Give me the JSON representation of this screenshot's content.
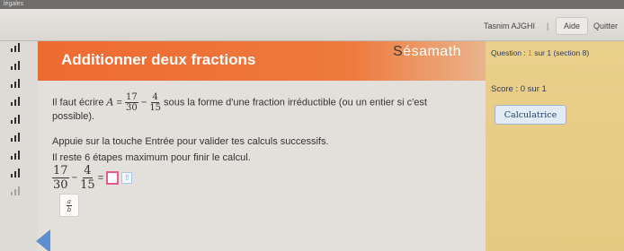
{
  "browser": {
    "tab_fragment": "légales"
  },
  "user": {
    "name": "Tasnim AJGHI",
    "separator": "|",
    "help": "Aide",
    "quit": "Quitter"
  },
  "header": {
    "title": "Additionner deux fractions",
    "logo_prefix": "S",
    "logo_rest": "ésamath"
  },
  "side": {
    "question_prefix": "Question : ",
    "question_current": "1",
    "question_suffix": " sur 1  (section 8)",
    "score": "Score : 0 sur 1",
    "calc_button": "Calculatrice"
  },
  "content": {
    "line1_pre": "Il faut écrire ",
    "A_var": "A",
    "equals": " = ",
    "minus": " − ",
    "frac1": {
      "num": "17",
      "den": "30"
    },
    "frac2": {
      "num": "4",
      "den": "15"
    },
    "line1_post": " sous la forme d'une fraction irréductible (ou un entier si c'est",
    "line2": "possible).",
    "line3": "Appuie sur la touche Entrée pour valider tes calculs successifs.",
    "line4": "Il reste 6 étapes maximum pour finir le calcul.",
    "answer_equals": "=",
    "up_arrow": "⇧",
    "tool_num": "a",
    "tool_den": "b"
  },
  "colors": {
    "header": "#ef6a33",
    "side_panel": "#e9d08a",
    "answer_border": "#e85a8c",
    "nav_arrow": "#5c8fcf"
  },
  "icons": {
    "section_marker": "signal-bars-icon",
    "nav": "triangle-left-icon"
  }
}
